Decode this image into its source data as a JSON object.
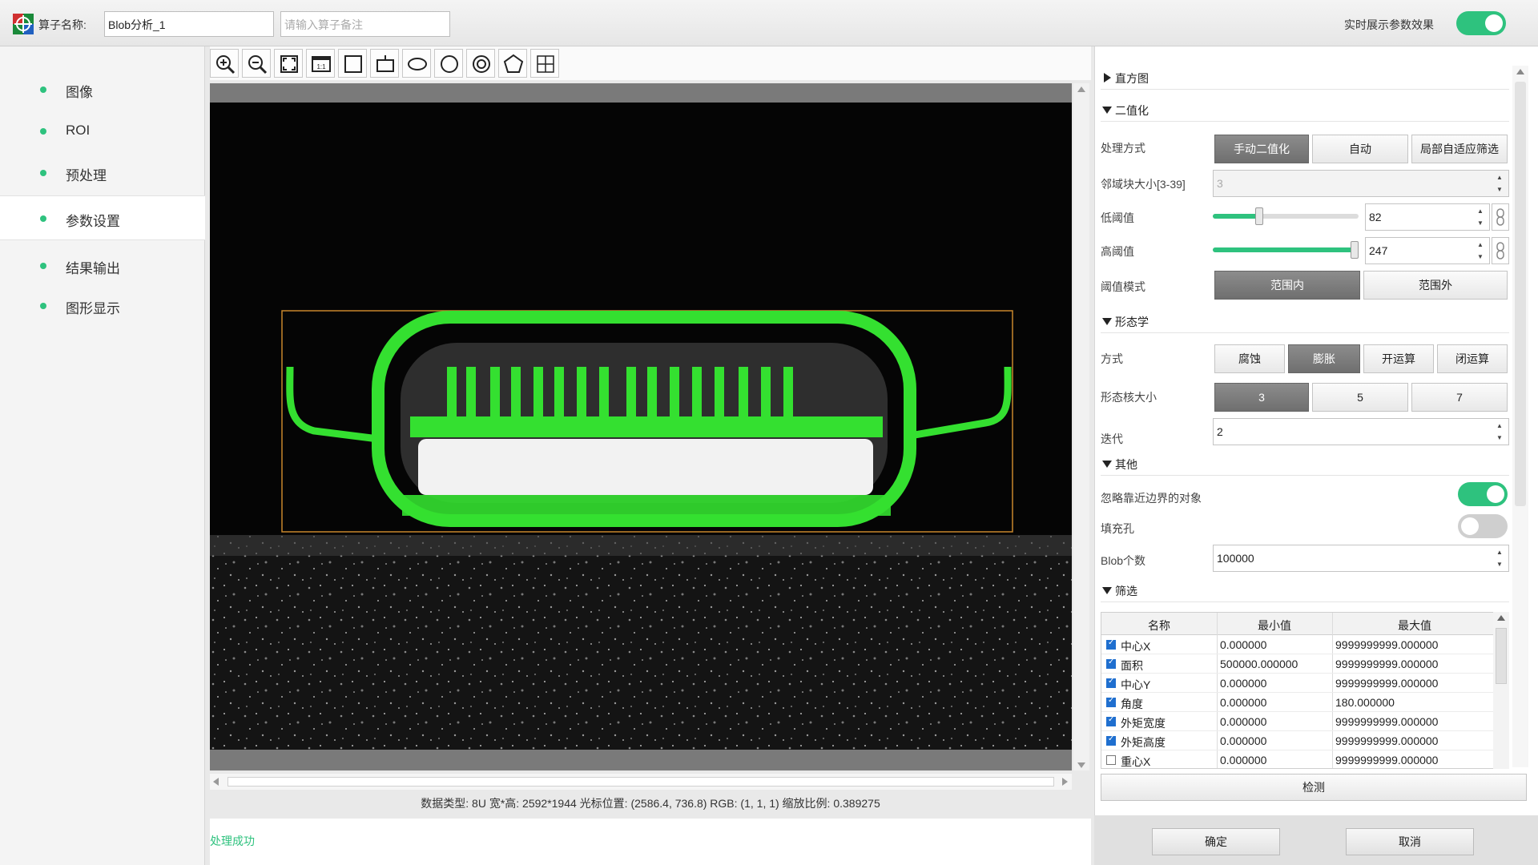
{
  "header": {
    "name_label": "算子名称:",
    "name_value": "Blob分析_1",
    "remark_placeholder": "请输入算子备注",
    "realtime_label": "实时展示参数效果",
    "realtime_on": true
  },
  "sidebar": {
    "items": [
      {
        "label": "图像",
        "active": false
      },
      {
        "label": "ROI",
        "active": false
      },
      {
        "label": "预处理",
        "active": false
      },
      {
        "label": "参数设置",
        "active": true
      },
      {
        "label": "结果输出",
        "active": false
      },
      {
        "label": "图形显示",
        "active": false
      }
    ]
  },
  "toolbar": {
    "tools": [
      "zoom-in-icon",
      "zoom-out-icon",
      "fit-screen-icon",
      "actual-size-icon",
      "rectangle-icon",
      "rotated-rectangle-icon",
      "ellipse-icon",
      "circle-icon",
      "annulus-icon",
      "polygon-icon",
      "crosshair-icon"
    ],
    "actual_size_label": "1:1"
  },
  "viewer": {
    "info": "数据类型: 8U 宽*高: 2592*1944 光标位置: (2586.4, 736.8) RGB: (1, 1, 1) 缩放比例: 0.389275",
    "status": "处理成功",
    "roi_color": "#c8862c",
    "blob_color": "#34e030"
  },
  "panel": {
    "sections": {
      "histogram": "直方图",
      "binarize": "二值化",
      "morph": "形态学",
      "other": "其他",
      "filter": "筛选"
    },
    "method_label": "处理方式",
    "method_options": [
      "手动二值化",
      "自动",
      "局部自适应筛选"
    ],
    "method_selected": 0,
    "neighborhood_label": "邻域块大小[3-39]",
    "neighborhood_value": "3",
    "low_label": "低阈值",
    "low_value": "82",
    "low_fraction": 0.32,
    "high_label": "高阈值",
    "high_value": "247",
    "high_fraction": 0.97,
    "thresh_mode_label": "阈值模式",
    "thresh_mode_options": [
      "范围内",
      "范围外"
    ],
    "thresh_mode_selected": 0,
    "morph_mode_label": "方式",
    "morph_mode_options": [
      "腐蚀",
      "膨胀",
      "开运算",
      "闭运算"
    ],
    "morph_mode_selected": 1,
    "kernel_label": "形态核大小",
    "kernel_options": [
      "3",
      "5",
      "7"
    ],
    "kernel_selected": 0,
    "iter_label": "迭代",
    "iter_value": "2",
    "ignore_border_label": "忽略靠近边界的对象",
    "ignore_border_on": true,
    "fill_holes_label": "填充孔",
    "fill_holes_on": false,
    "blob_count_label": "Blob个数",
    "blob_count_value": "100000",
    "table": {
      "headers": [
        "名称",
        "最小值",
        "最大值"
      ],
      "rows": [
        {
          "checked": true,
          "name": "中心X",
          "min": "0.000000",
          "max": "9999999999.000000"
        },
        {
          "checked": true,
          "name": "面积",
          "min": "500000.000000",
          "max": "9999999999.000000"
        },
        {
          "checked": true,
          "name": "中心Y",
          "min": "0.000000",
          "max": "9999999999.000000"
        },
        {
          "checked": true,
          "name": "角度",
          "min": "0.000000",
          "max": "180.000000"
        },
        {
          "checked": true,
          "name": "外矩宽度",
          "min": "0.000000",
          "max": "9999999999.000000"
        },
        {
          "checked": true,
          "name": "外矩高度",
          "min": "0.000000",
          "max": "9999999999.000000"
        },
        {
          "checked": false,
          "name": "重心X",
          "min": "0.000000",
          "max": "9999999999.000000"
        }
      ]
    },
    "detect_label": "检测"
  },
  "footer": {
    "ok_label": "确定",
    "cancel_label": "取消"
  },
  "colors": {
    "accent": "#2ec27e",
    "selected_button": "#7a7a7a"
  }
}
